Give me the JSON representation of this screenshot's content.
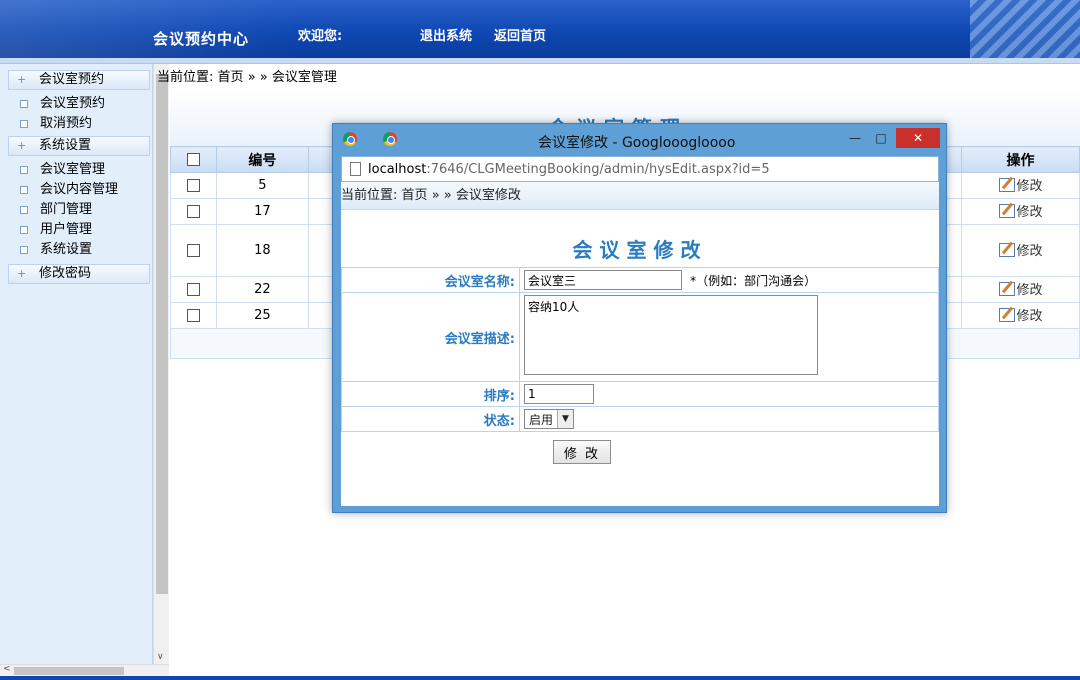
{
  "header": {
    "app_title": "会议预约中心",
    "welcome": "欢迎您:",
    "logout": "退出系统",
    "home": "返回首页"
  },
  "sidebar": {
    "group1": "会议室预约",
    "g1_items": [
      "会议室预约",
      "取消预约"
    ],
    "group2": "系统设置",
    "g2_items": [
      "会议室管理",
      "会议内容管理",
      "部门管理",
      "用户管理",
      "系统设置"
    ],
    "group3": "修改密码"
  },
  "main": {
    "crumb_prefix": "当前位置:",
    "crumb_home": "首页",
    "crumb_sep": "» »",
    "crumb_page": "会议室管理",
    "title": "会议室管理",
    "table": {
      "headers": [
        "编号",
        "操作"
      ],
      "rows": [
        {
          "id": "5",
          "action": "修改"
        },
        {
          "id": "17",
          "action": "修改"
        },
        {
          "id": "18",
          "action": "修改"
        },
        {
          "id": "22",
          "action": "修改"
        },
        {
          "id": "25",
          "action": "修改"
        }
      ]
    }
  },
  "dialog": {
    "window_title": "会议室修改 - Googlooogloooo",
    "url_host": "localhost",
    "url_rest": ":7646/CLGMeetingBooking/admin/hysEdit.aspx?id=5",
    "crumb_prefix": "当前位置:",
    "crumb_home": "首页",
    "crumb_sep": "» »",
    "crumb_page": "会议室修改",
    "heading": "会议室修改",
    "fields": {
      "name_label": "会议室名称:",
      "name_value": "会议室三",
      "name_hint": "*（例如：部门沟通会）",
      "desc_label": "会议室描述:",
      "desc_value": "容纳10人",
      "order_label": "排序:",
      "order_value": "1",
      "status_label": "状态:",
      "status_value": "启用"
    },
    "submit_label": "修 改"
  },
  "colors": {
    "header_blue": "#0f48b3",
    "title_blue": "#2b7bc0",
    "dialog_frame": "#5e9fd6",
    "close_red": "#c9302c"
  },
  "icons": [
    "chrome-icon",
    "document-icon",
    "edit-icon",
    "minimize-icon",
    "maximize-icon",
    "close-icon",
    "tree-plus-icon",
    "tree-node-icon"
  ]
}
